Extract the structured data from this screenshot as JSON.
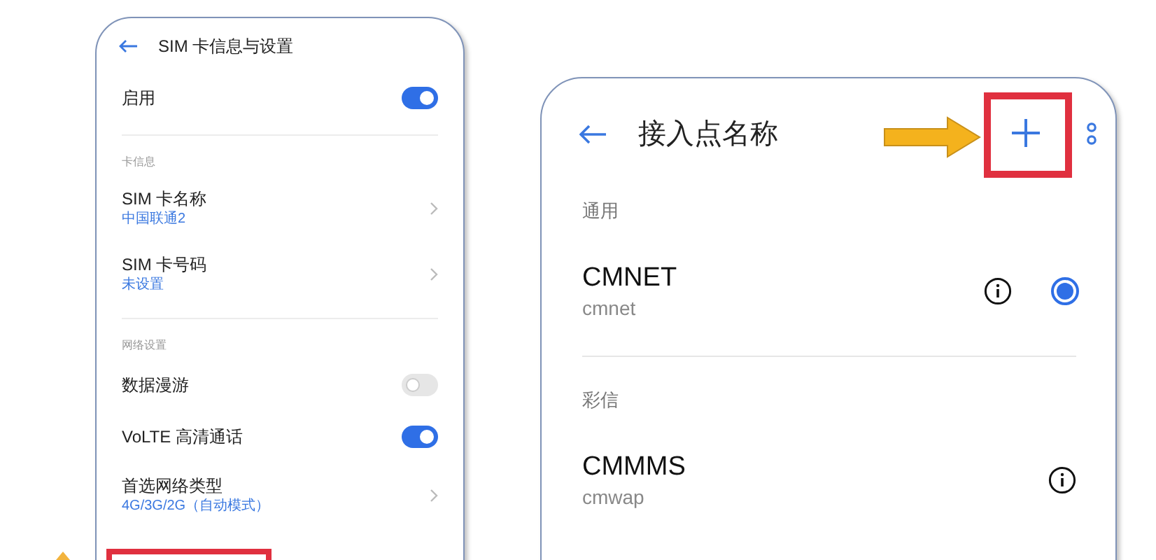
{
  "sim_settings": {
    "title": "SIM 卡信息与设置",
    "rows": [
      {
        "kind": "toggle",
        "label": "启用",
        "on": true
      },
      {
        "kind": "divider"
      },
      {
        "kind": "section",
        "label": "卡信息"
      },
      {
        "kind": "nav",
        "label": "SIM 卡名称",
        "value": "中国联通2"
      },
      {
        "kind": "nav",
        "label": "SIM 卡号码",
        "value": "未设置"
      },
      {
        "kind": "divider"
      },
      {
        "kind": "section",
        "label": "网络设置"
      },
      {
        "kind": "toggle",
        "label": "数据漫游",
        "on": false
      },
      {
        "kind": "toggle",
        "label": "VoLTE 高清通话",
        "on": true
      },
      {
        "kind": "nav",
        "label": "首选网络类型",
        "value": "4G/3G/2G（自动模式）"
      }
    ]
  },
  "apn_list": {
    "title": "接入点名称",
    "sections": [
      {
        "label": "通用",
        "items": [
          {
            "kind": "radio",
            "name": "CMNET",
            "apn": "cmnet",
            "selected": true
          }
        ]
      },
      {
        "label": "彩信",
        "items": [
          {
            "kind": "plain",
            "name": "CMMMS",
            "apn": "cmwap"
          }
        ]
      }
    ]
  }
}
